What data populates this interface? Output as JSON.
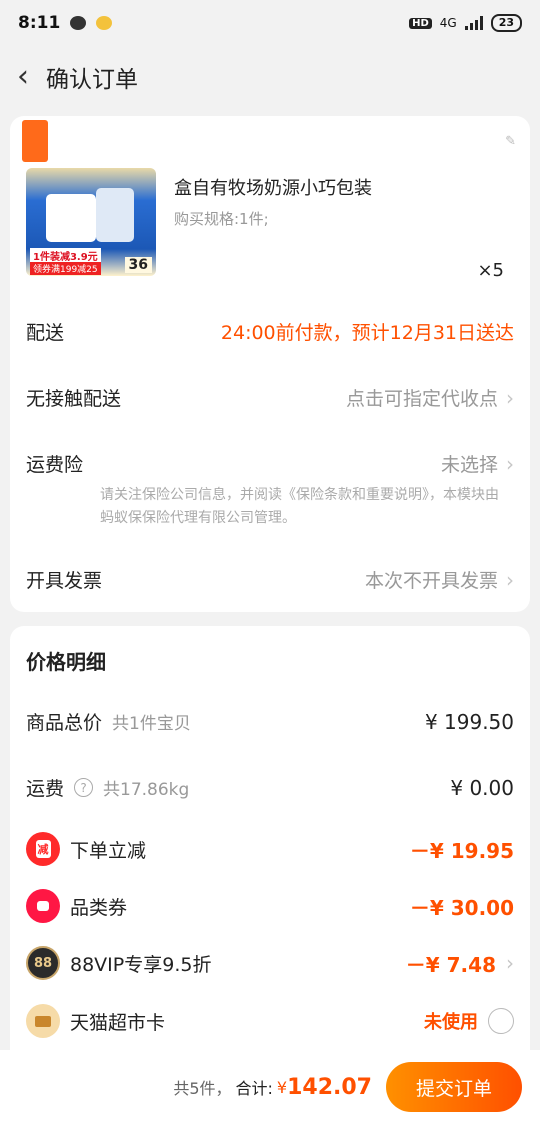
{
  "status_bar": {
    "time": "8:11",
    "network": "4G",
    "battery": "23",
    "hd": "HD"
  },
  "nav": {
    "title": "确认订单"
  },
  "product": {
    "title": "盒自有牧场奶源小巧包装",
    "spec": "购买规格:1件;",
    "quantity": "×5",
    "image_tag_1": "1件装减3.9元",
    "image_tag_2": "领券满199减25",
    "image_price": "36"
  },
  "delivery": {
    "label": "配送",
    "value": "24:00前付款，预计12月31日送达"
  },
  "contactless": {
    "label": "无接触配送",
    "value": "点击可指定代收点"
  },
  "shipping_insurance": {
    "label": "运费险",
    "value": "未选择",
    "note": "请关注保险公司信息，并阅读《保险条款和重要说明》，本模块由蚂蚁保保险代理有限公司管理。"
  },
  "invoice": {
    "label": "开具发票",
    "value": "本次不开具发票"
  },
  "price_detail": {
    "title": "价格明细",
    "goods_total": {
      "label": "商品总价",
      "sub": "共1件宝贝",
      "amount": "¥ 199.50"
    },
    "freight": {
      "label": "运费",
      "sub": "共17.86kg",
      "amount": "¥ 0.00"
    },
    "order_discount": {
      "label": "下单立减",
      "amount": "－¥ 19.95",
      "icon_text": "减"
    },
    "category_coupon": {
      "label": "品类券",
      "amount": "－¥ 30.00"
    },
    "vip": {
      "label": "88VIP专享9.5折",
      "amount": "－¥ 7.48",
      "icon_text": "88"
    },
    "supermarket_card": {
      "label": "天猫超市卡",
      "amount": "未使用"
    }
  },
  "bottom": {
    "count_text": "共5件，",
    "total_label": "合计:",
    "total_symbol": "¥",
    "total_amount": "142.07",
    "submit_label": "提交订单"
  },
  "colors": {
    "accent": "#ff5000",
    "background": "#f2f2f2"
  }
}
